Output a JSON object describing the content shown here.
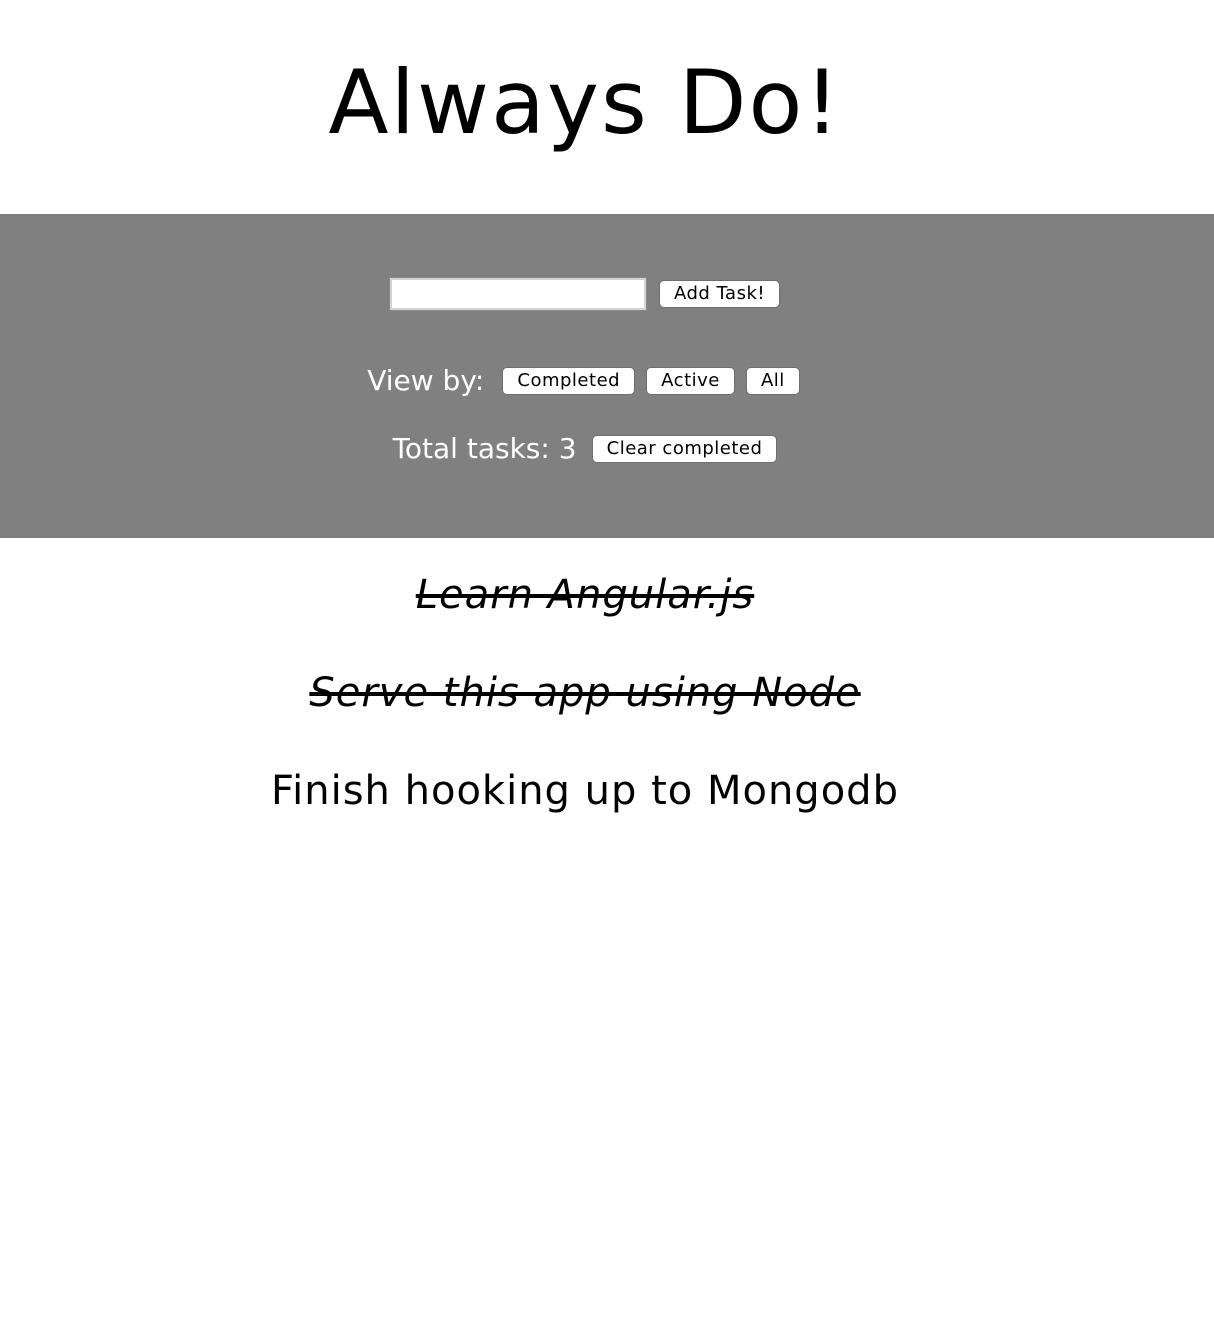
{
  "header": {
    "title": "Always Do!"
  },
  "add_form": {
    "input_value": "",
    "placeholder": "",
    "add_button_label": "Add Task!"
  },
  "filter": {
    "label": "View by:",
    "completed_label": "Completed",
    "active_label": "Active",
    "all_label": "All"
  },
  "summary": {
    "total_text": "Total tasks: 3",
    "clear_label": "Clear completed"
  },
  "tasks": [
    {
      "text": "Learn Angular.js",
      "completed": true
    },
    {
      "text": "Serve this app using Node",
      "completed": true
    },
    {
      "text": "Finish hooking up to Mongodb",
      "completed": false
    }
  ],
  "colors": {
    "panel": "#808080",
    "background": "#ffffff",
    "text": "#000000",
    "panel_text": "#ffffff"
  }
}
